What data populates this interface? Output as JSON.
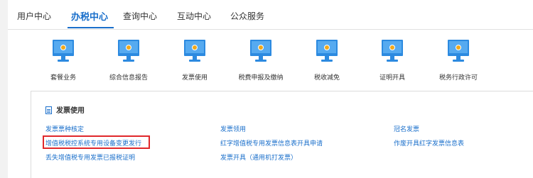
{
  "top_tabs": [
    {
      "label": "用户中心",
      "active": false
    },
    {
      "label": "办税中心",
      "active": true
    },
    {
      "label": "查询中心",
      "active": false
    },
    {
      "label": "互动中心",
      "active": false
    },
    {
      "label": "公众服务",
      "active": false
    }
  ],
  "service_icons": [
    {
      "label": "套餐业务",
      "icon": "monitor-icon"
    },
    {
      "label": "综合信息报告",
      "icon": "monitor-icon"
    },
    {
      "label": "发票使用",
      "icon": "monitor-icon"
    },
    {
      "label": "税费申报及缴纳",
      "icon": "monitor-icon"
    },
    {
      "label": "税收减免",
      "icon": "monitor-icon"
    },
    {
      "label": "证明开具",
      "icon": "monitor-icon"
    },
    {
      "label": "税务行政许可",
      "icon": "monitor-icon"
    }
  ],
  "dropdown": {
    "title": "发票使用",
    "links": [
      "发票票种核定",
      "增值税税控系统专用设备变更发行",
      "丢失增值税专用发票已报税证明",
      "发票领用",
      "红字增值税专用发票信息表开具申请",
      "发票开具（通用机打发票）",
      "冠名发票",
      "作废开具红字发票信息表"
    ]
  },
  "colors": {
    "accent": "#1a6fcb",
    "highlight_border": "#e0282b",
    "icon_blue": "#2c8ae0",
    "icon_orange": "#f0a81c"
  }
}
